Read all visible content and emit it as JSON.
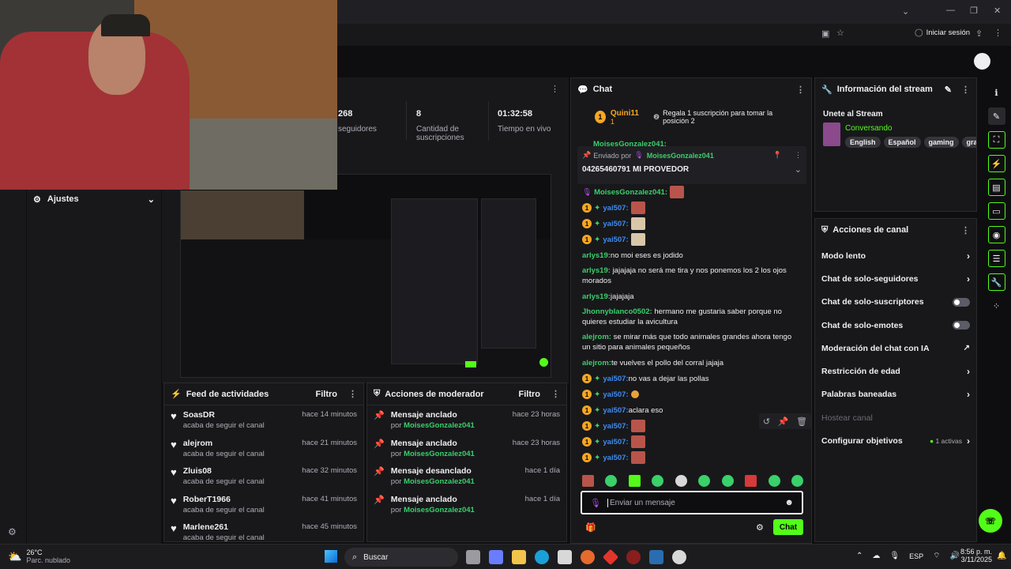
{
  "browser": {
    "signin_label": "Iniciar sesión"
  },
  "stats": {
    "followers_value": "268",
    "followers_label": "seguidores",
    "subs_value": "8",
    "subs_label_1": "Cantidad de",
    "subs_label_2": "suscripciones",
    "time_value": "01:32:58",
    "time_label": "Tiempo en vivo"
  },
  "settings": {
    "label": "Ajustes"
  },
  "feed": {
    "title": "Feed de actividades",
    "filter": "Filtro",
    "items": [
      {
        "name": "SoasDR",
        "sub": "acaba de seguir el canal",
        "time": "hace 14 minutos"
      },
      {
        "name": "alejrom",
        "sub": "acaba de seguir el canal",
        "time": "hace 21 minutos"
      },
      {
        "name": "Zluis08",
        "sub": "acaba de seguir el canal",
        "time": "hace 32 minutos"
      },
      {
        "name": "RoberT1966",
        "sub": "acaba de seguir el canal",
        "time": "hace 41 minutos"
      },
      {
        "name": "Marlene261",
        "sub": "acaba de seguir el canal",
        "time": "hace 45 minutos"
      }
    ]
  },
  "modactions": {
    "title": "Acciones de moderador",
    "filter": "Filtro",
    "items": [
      {
        "action": "Mensaje anclado",
        "by": "por",
        "user": "MoisesGonzalez041",
        "time": "hace 23 horas"
      },
      {
        "action": "Mensaje anclado",
        "by": "por",
        "user": "MoisesGonzalez041",
        "time": "hace 23 horas"
      },
      {
        "action": "Mensaje desanclado",
        "by": "por",
        "user": "MoisesGonzalez041",
        "time": "hace 1 día"
      },
      {
        "action": "Mensaje anclado",
        "by": "por",
        "user": "MoisesGonzalez041",
        "time": "hace 1 día"
      }
    ]
  },
  "chat": {
    "title": "Chat",
    "top_gifter": "Quini11",
    "top_gifter_count": "1",
    "gift_prompt": "Regala 1 suscripción para tomar la posición 2",
    "pinned_by_label": "Enviado por",
    "pinned_by_user": "MoisesGonzalez041",
    "pinned_message": "04265460791 MI PROVEDOR",
    "top_user": "MoisesGonzalez041:",
    "messages": [
      {
        "user": "MoisesGonzalez041:",
        "text": "",
        "color": "#3ad06a",
        "badges": "mic",
        "emote": "r"
      },
      {
        "user": "yai507:",
        "text": "",
        "color": "#3b8cf5",
        "badges": "sub",
        "emote": "r"
      },
      {
        "user": "yai507:",
        "text": "",
        "color": "#3b8cf5",
        "badges": "sub",
        "emote": "w"
      },
      {
        "user": "yai507:",
        "text": "",
        "color": "#3b8cf5",
        "badges": "sub",
        "emote": "w"
      },
      {
        "user": "arlys19:",
        "text": "no moi eses es jodido",
        "color": "#3ad06a",
        "badges": "",
        "emote": ""
      },
      {
        "user": "arlys19:",
        "text": "jajajaja no será me tira y nos ponemos los 2 los ojos morados",
        "color": "#3ad06a",
        "badges": "",
        "emote": ""
      },
      {
        "user": "arlys19:",
        "text": "jajajaja",
        "color": "#3ad06a",
        "badges": "",
        "emote": ""
      },
      {
        "user": "Jhonnyblanco0502:",
        "text": "hermano me gustaria saber porque no quieres estudiar la avicultura",
        "color": "#3ad06a",
        "badges": "",
        "emote": ""
      },
      {
        "user": "alejrom:",
        "text": "se mirar más que todo animales grandes ahora tengo un sitio para animales pequeños",
        "color": "#3ad06a",
        "badges": "",
        "emote": ""
      },
      {
        "user": "alejrom:",
        "text": "te vuelves el pollo del corral jajaja",
        "color": "#3ad06a",
        "badges": "",
        "emote": ""
      },
      {
        "user": "yai507:",
        "text": "no vas a dejar las pollas",
        "color": "#3b8cf5",
        "badges": "sub",
        "emote": ""
      },
      {
        "user": "yai507:",
        "text": "",
        "color": "#3b8cf5",
        "badges": "sub",
        "emote": "o"
      },
      {
        "user": "yai507:",
        "text": "aclara eso",
        "color": "#3b8cf5",
        "badges": "sub",
        "emote": ""
      },
      {
        "user": "yai507:",
        "text": "",
        "color": "#3b8cf5",
        "badges": "sub",
        "emote": "r"
      },
      {
        "user": "yai507:",
        "text": "",
        "color": "#3b8cf5",
        "badges": "sub",
        "emote": "r"
      },
      {
        "user": "yai507:",
        "text": "",
        "color": "#3b8cf5",
        "badges": "sub",
        "emote": "r"
      }
    ],
    "input_placeholder": "Enviar un mensaje",
    "send_label": "Chat"
  },
  "stream_info": {
    "title": "Información del stream",
    "stream_title": "Unete al Stream",
    "category": "Conversando",
    "tags": [
      "English",
      "Español",
      "gaming",
      "grat"
    ]
  },
  "channel_actions": {
    "title": "Acciones de canal",
    "items": [
      {
        "label": "Modo lento",
        "control": "chevron"
      },
      {
        "label": "Chat de solo-seguidores",
        "control": "chevron"
      },
      {
        "label": "Chat de solo-suscriptores",
        "control": "toggle"
      },
      {
        "label": "Chat de solo-emotes",
        "control": "toggle"
      },
      {
        "label": "Moderación del chat con IA",
        "control": "external"
      },
      {
        "label": "Restricción de edad",
        "control": "chevron"
      },
      {
        "label": "Palabras baneadas",
        "control": "chevron"
      },
      {
        "label": "Hostear canal",
        "control": "none"
      },
      {
        "label": "Configurar objetivos",
        "control": "chevron"
      }
    ],
    "goals_active": "1 activas"
  },
  "taskbar": {
    "weather_temp": "26°C",
    "weather_desc": "Parc. nublado",
    "search_label": "Buscar",
    "lang": "ESP",
    "time": "8:56 p. m.",
    "date": "3/11/2025"
  },
  "colors": {
    "accent": "#53fc18",
    "bg": "#0e0e10",
    "panel": "#18181b",
    "sub_blue": "#3b8cf5",
    "user_green": "#3ad06a"
  }
}
